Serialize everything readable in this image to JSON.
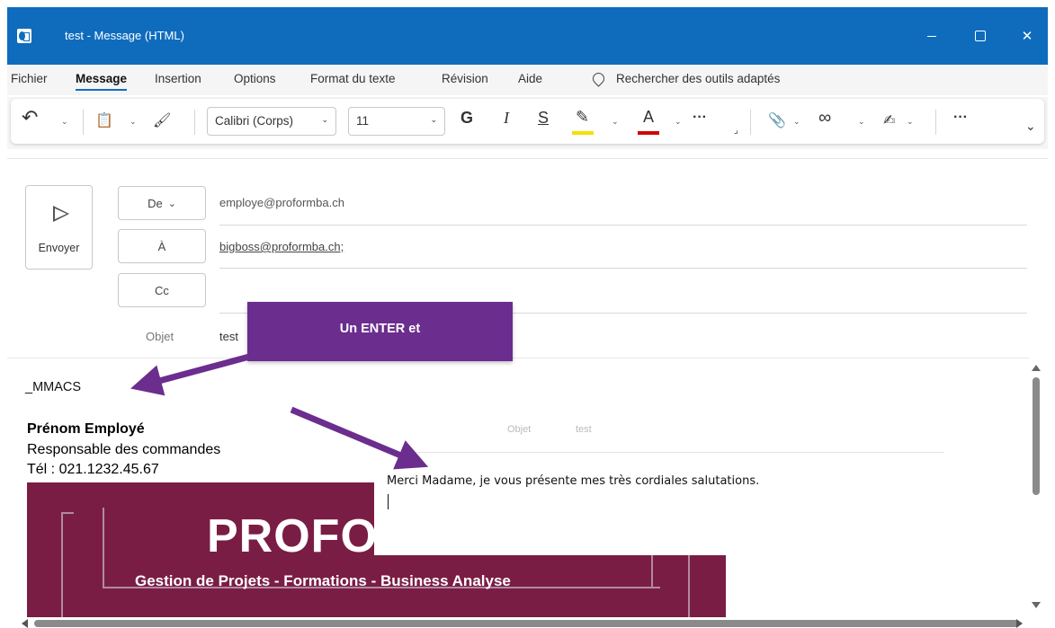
{
  "window": {
    "title": "test  -  Message (HTML)",
    "close_glyph": "✕"
  },
  "menu": {
    "tabs": [
      "Fichier",
      "Message",
      "Insertion",
      "Options",
      "Format du texte",
      "Révision",
      "Aide"
    ],
    "active_tab": "Message",
    "search_placeholder": "Rechercher des outils adaptés"
  },
  "ribbon": {
    "undo_glyph": "↶",
    "clipboard_glyph": "📋",
    "format_painter_glyph": "🖌",
    "font_name": "Calibri (Corps)",
    "font_size": "11",
    "bold": "G",
    "italic": "I",
    "underline": "S",
    "highlighter_glyph": "✎",
    "font_color": "A",
    "more": "···",
    "attach_glyph": "📎",
    "link_glyph": "∞",
    "signature_glyph": "✍",
    "overflow": "···",
    "dialog_launcher": "⌟",
    "collapse": "⌄",
    "chevron": "⌄",
    "highlight_color": "#f4e100",
    "font_color_value": "#d00000"
  },
  "compose": {
    "send_label": "Envoyer",
    "from_label": "De",
    "from_chevron": "⌄",
    "from_value": "employe@proformba.ch",
    "to_label": "À",
    "to_value": "bigboss@proformba.ch;",
    "cc_label": "Cc",
    "subject_label": "Objet",
    "subject_value": "test"
  },
  "body": {
    "typed": "_MMACS",
    "signature_name": "Prénom Employé",
    "signature_role": "Responsable des commandes",
    "signature_tel": "Tél : 021.1232.45.67",
    "banner_brand": "PROFORMBA",
    "banner_tagline": "Gestion de Projets - Formations -  Business Analyse",
    "brand_color": "#7a1d45"
  },
  "overlay": {
    "ghost_label": "Objet",
    "ghost_value": "test",
    "reply_text": "Merci Madame, je vous présente mes très cordiales salutations."
  },
  "callout": {
    "text": "Un ENTER et",
    "color": "#6b2d8e"
  }
}
